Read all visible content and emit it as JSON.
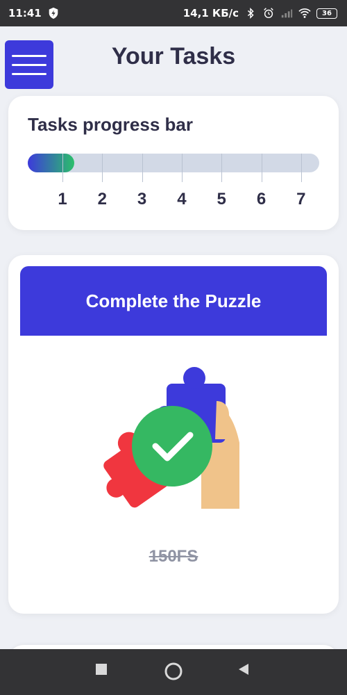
{
  "status_bar": {
    "time": "11:41",
    "network_speed": "14,1 КБ/с",
    "battery": "36",
    "icons": [
      "shield-icon",
      "bluetooth-icon",
      "alarm-icon",
      "signal-icon",
      "wifi-icon",
      "battery-icon"
    ]
  },
  "header": {
    "title": "Your Tasks",
    "menu_icon": "hamburger-menu-icon"
  },
  "progress": {
    "title": "Tasks progress bar",
    "current": 1,
    "total": 7,
    "fill_fraction": 0.16,
    "steps": [
      "1",
      "2",
      "3",
      "4",
      "5",
      "6",
      "7"
    ]
  },
  "task": {
    "title": "Complete the Puzzle",
    "reward": "150FS",
    "completed": true,
    "illustration": "puzzle-check-icon"
  },
  "nav": {
    "icons": [
      "recents-square-icon",
      "home-circle-icon",
      "back-triangle-icon"
    ]
  },
  "colors": {
    "accent": "#3d3adb",
    "success": "#2bbf6a",
    "text_dark": "#2f2e48",
    "puzzle_red": "#f0363f",
    "puzzle_blue": "#3d3adb",
    "hand": "#f0c38a",
    "background": "#eef0f5"
  }
}
